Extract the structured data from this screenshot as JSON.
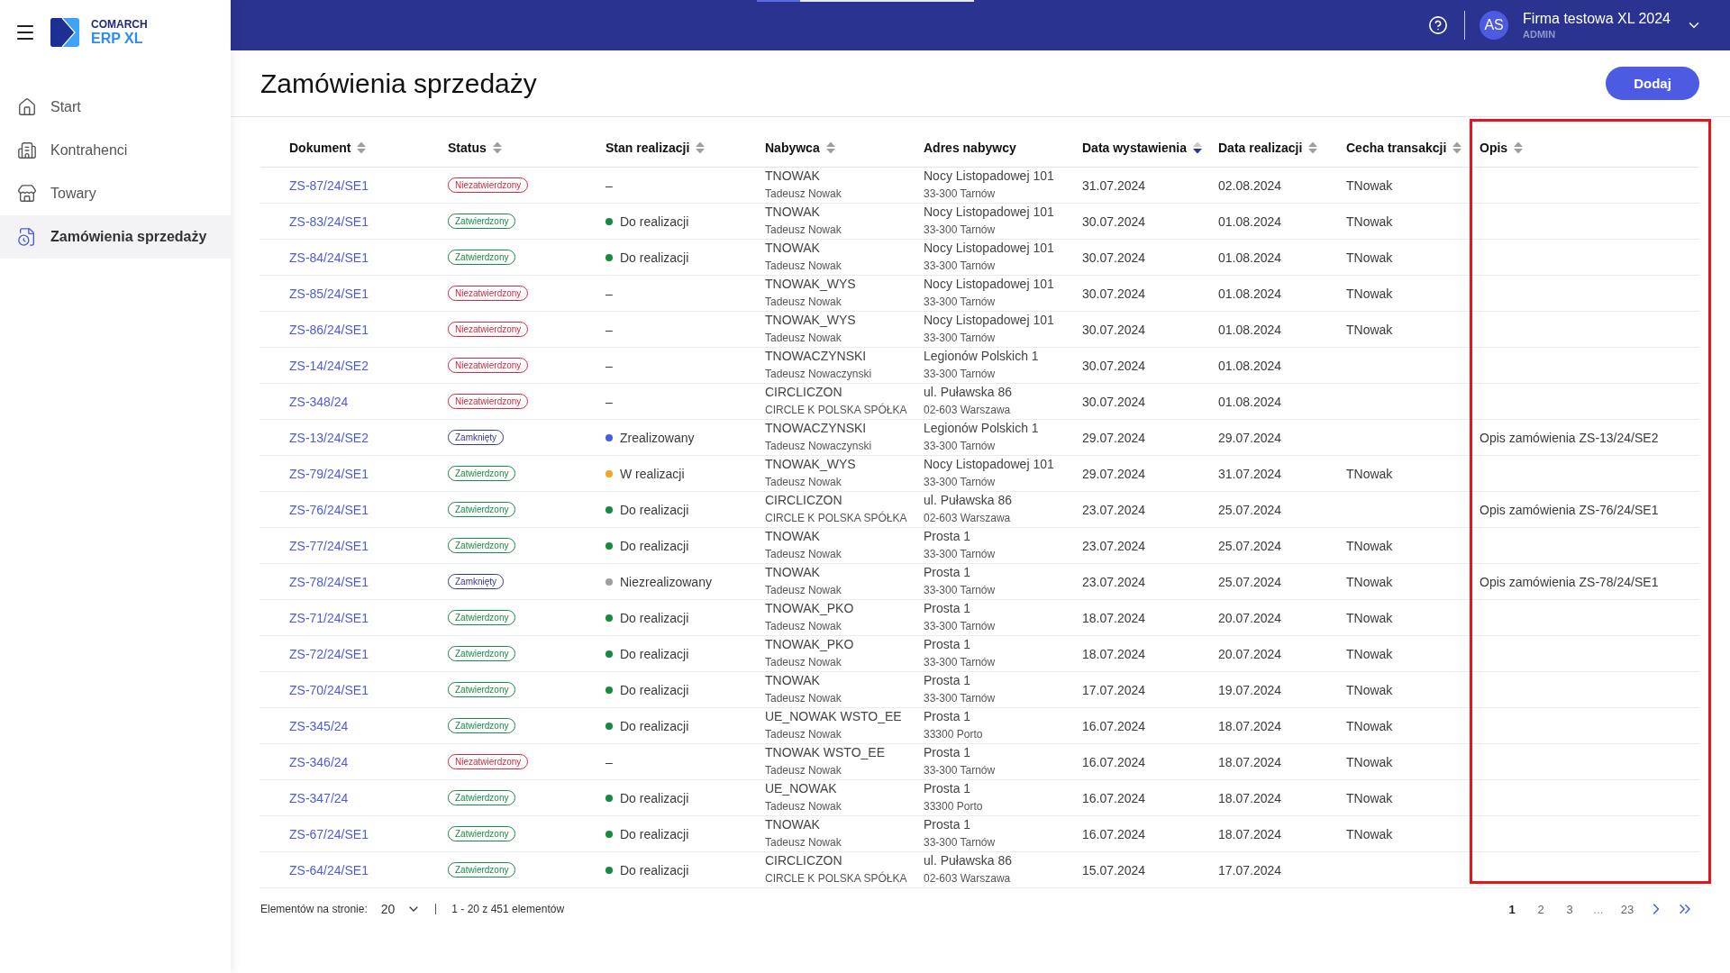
{
  "sidebar": {
    "logo": {
      "brand": "COMARCH",
      "product": "ERP XL"
    },
    "items": [
      {
        "label": "Start",
        "selected": false
      },
      {
        "label": "Kontrahenci",
        "selected": false
      },
      {
        "label": "Towary",
        "selected": false
      },
      {
        "label": "Zamówienia sprzedaży",
        "selected": true
      }
    ]
  },
  "top_bar": {
    "user": {
      "initials": "AS",
      "company": "Firma testowa XL 2024",
      "role": "ADMIN"
    }
  },
  "page": {
    "title": "Zamówienia sprzedaży",
    "add_button": "Dodaj"
  },
  "table": {
    "columns": [
      {
        "label": "Dokument",
        "sortable": true,
        "sorted_descending": false,
        "highlighted": false
      },
      {
        "label": "Status",
        "sortable": true,
        "sorted_descending": false,
        "highlighted": false
      },
      {
        "label": "Stan realizacji",
        "sortable": true,
        "sorted_descending": false,
        "highlighted": false
      },
      {
        "label": "Nabywca",
        "sortable": true,
        "sorted_descending": false,
        "highlighted": false
      },
      {
        "label": "Adres nabywcy",
        "sortable": false,
        "highlighted": false
      },
      {
        "label": "Data wystawienia",
        "sortable": true,
        "sorted_descending": true,
        "highlighted": false
      },
      {
        "label": "Data realizacji",
        "sortable": true,
        "sorted_descending": false,
        "highlighted": false
      },
      {
        "label": "Cecha transakcji",
        "sortable": true,
        "sorted_descending": false,
        "highlighted": false
      },
      {
        "label": "Opis",
        "sortable": true,
        "sorted_descending": false,
        "highlighted": true
      }
    ],
    "rows": [
      {
        "document": "ZS-87/24/SE1",
        "status": {
          "label": "Niezatwierdzony",
          "color": "#d7263d"
        },
        "progress": {
          "label": "–"
        },
        "buyer": {
          "code": "TNOWAK",
          "name": "Tadeusz Nowak"
        },
        "address": {
          "street": "Nocy Listopadowej 101",
          "city": "33-300 Tarnów"
        },
        "issue_date": "31.07.2024",
        "due_date": "02.08.2024",
        "feature": "TNowak"
      },
      {
        "document": "ZS-83/24/SE1",
        "status": {
          "label": "Zatwierdzony",
          "color": "#168a3e"
        },
        "progress": {
          "label": "Do realizacji",
          "color": "#168a3e"
        },
        "buyer": {
          "code": "TNOWAK",
          "name": "Tadeusz Nowak"
        },
        "address": {
          "street": "Nocy Listopadowej 101",
          "city": "33-300 Tarnów"
        },
        "issue_date": "30.07.2024",
        "due_date": "01.08.2024",
        "feature": "TNowak"
      },
      {
        "document": "ZS-84/24/SE1",
        "status": {
          "label": "Zatwierdzony",
          "color": "#168a3e"
        },
        "progress": {
          "label": "Do realizacji",
          "color": "#168a3e"
        },
        "buyer": {
          "code": "TNOWAK",
          "name": "Tadeusz Nowak"
        },
        "address": {
          "street": "Nocy Listopadowej 101",
          "city": "33-300 Tarnów"
        },
        "issue_date": "30.07.2024",
        "due_date": "01.08.2024",
        "feature": "TNowak"
      },
      {
        "document": "ZS-85/24/SE1",
        "status": {
          "label": "Niezatwierdzony",
          "color": "#d7263d"
        },
        "progress": {
          "label": "–"
        },
        "buyer": {
          "code": "TNOWAK_WYS",
          "name": "Tadeusz Nowak"
        },
        "address": {
          "street": "Nocy Listopadowej 101",
          "city": "33-300 Tarnów"
        },
        "issue_date": "30.07.2024",
        "due_date": "01.08.2024",
        "feature": "TNowak"
      },
      {
        "document": "ZS-86/24/SE1",
        "status": {
          "label": "Niezatwierdzony",
          "color": "#d7263d"
        },
        "progress": {
          "label": "–"
        },
        "buyer": {
          "code": "TNOWAK_WYS",
          "name": "Tadeusz Nowak"
        },
        "address": {
          "street": "Nocy Listopadowej 101",
          "city": "33-300 Tarnów"
        },
        "issue_date": "30.07.2024",
        "due_date": "01.08.2024",
        "feature": "TNowak"
      },
      {
        "document": "ZS-14/24/SE2",
        "status": {
          "label": "Niezatwierdzony",
          "color": "#d7263d"
        },
        "progress": {
          "label": "–"
        },
        "buyer": {
          "code": "TNOWACZYNSKI",
          "name": "Tadeusz Nowaczynski"
        },
        "address": {
          "street": "Legionów Polskich 1",
          "city": "33-300 Tarnów"
        },
        "issue_date": "30.07.2024",
        "due_date": "01.08.2024"
      },
      {
        "document": "ZS-348/24",
        "status": {
          "label": "Niezatwierdzony",
          "color": "#d7263d"
        },
        "progress": {
          "label": "–"
        },
        "buyer": {
          "code": "CIRCLICZON",
          "name": "CIRCLE K POLSKA SPÓŁKA"
        },
        "address": {
          "street": "ul. Puławska 86",
          "city": "02-603 Warszawa"
        },
        "issue_date": "30.07.2024",
        "due_date": "01.08.2024"
      },
      {
        "document": "ZS-13/24/SE2",
        "status": {
          "label": "Zamknięty",
          "color": "#2f3a8f"
        },
        "progress": {
          "label": "Zrealizowany",
          "color": "#4b5be0"
        },
        "buyer": {
          "code": "TNOWACZYNSKI",
          "name": "Tadeusz Nowaczynski"
        },
        "address": {
          "street": "Legionów Polskich 1",
          "city": "33-300 Tarnów"
        },
        "issue_date": "29.07.2024",
        "due_date": "29.07.2024",
        "description": "Opis zamówienia ZS-13/24/SE2"
      },
      {
        "document": "ZS-79/24/SE1",
        "status": {
          "label": "Zatwierdzony",
          "color": "#168a3e"
        },
        "progress": {
          "label": "W realizacji",
          "color": "#f5a524"
        },
        "buyer": {
          "code": "TNOWAK_WYS",
          "name": "Tadeusz Nowak"
        },
        "address": {
          "street": "Nocy Listopadowej 101",
          "city": "33-300 Tarnów"
        },
        "issue_date": "29.07.2024",
        "due_date": "31.07.2024",
        "feature": "TNowak"
      },
      {
        "document": "ZS-76/24/SE1",
        "status": {
          "label": "Zatwierdzony",
          "color": "#168a3e"
        },
        "progress": {
          "label": "Do realizacji",
          "color": "#168a3e"
        },
        "buyer": {
          "code": "CIRCLICZON",
          "name": "CIRCLE K POLSKA SPÓŁKA"
        },
        "address": {
          "street": "ul. Puławska 86",
          "city": "02-603 Warszawa"
        },
        "issue_date": "23.07.2024",
        "due_date": "25.07.2024",
        "description": "Opis zamówienia ZS-76/24/SE1"
      },
      {
        "document": "ZS-77/24/SE1",
        "status": {
          "label": "Zatwierdzony",
          "color": "#168a3e"
        },
        "progress": {
          "label": "Do realizacji",
          "color": "#168a3e"
        },
        "buyer": {
          "code": "TNOWAK",
          "name": "Tadeusz Nowak"
        },
        "address": {
          "street": "Prosta 1",
          "city": "33-300 Tarnów"
        },
        "issue_date": "23.07.2024",
        "due_date": "25.07.2024",
        "feature": "TNowak"
      },
      {
        "document": "ZS-78/24/SE1",
        "status": {
          "label": "Zamknięty",
          "color": "#2f3a8f"
        },
        "progress": {
          "label": "Niezrealizowany",
          "color": "#9e9e9e"
        },
        "buyer": {
          "code": "TNOWAK",
          "name": "Tadeusz Nowak"
        },
        "address": {
          "street": "Prosta 1",
          "city": "33-300 Tarnów"
        },
        "issue_date": "23.07.2024",
        "due_date": "25.07.2024",
        "feature": "TNowak",
        "description": "Opis zamówienia ZS-78/24/SE1"
      },
      {
        "document": "ZS-71/24/SE1",
        "status": {
          "label": "Zatwierdzony",
          "color": "#168a3e"
        },
        "progress": {
          "label": "Do realizacji",
          "color": "#168a3e"
        },
        "buyer": {
          "code": "TNOWAK_PKO",
          "name": "Tadeusz Nowak"
        },
        "address": {
          "street": "Prosta 1",
          "city": "33-300 Tarnów"
        },
        "issue_date": "18.07.2024",
        "due_date": "20.07.2024",
        "feature": "TNowak"
      },
      {
        "document": "ZS-72/24/SE1",
        "status": {
          "label": "Zatwierdzony",
          "color": "#168a3e"
        },
        "progress": {
          "label": "Do realizacji",
          "color": "#168a3e"
        },
        "buyer": {
          "code": "TNOWAK_PKO",
          "name": "Tadeusz Nowak"
        },
        "address": {
          "street": "Prosta 1",
          "city": "33-300 Tarnów"
        },
        "issue_date": "18.07.2024",
        "due_date": "20.07.2024",
        "feature": "TNowak"
      },
      {
        "document": "ZS-70/24/SE1",
        "status": {
          "label": "Zatwierdzony",
          "color": "#168a3e"
        },
        "progress": {
          "label": "Do realizacji",
          "color": "#168a3e"
        },
        "buyer": {
          "code": "TNOWAK",
          "name": "Tadeusz Nowak"
        },
        "address": {
          "street": "Prosta 1",
          "city": "33-300 Tarnów"
        },
        "issue_date": "17.07.2024",
        "due_date": "19.07.2024",
        "feature": "TNowak"
      },
      {
        "document": "ZS-345/24",
        "status": {
          "label": "Zatwierdzony",
          "color": "#168a3e"
        },
        "progress": {
          "label": "Do realizacji",
          "color": "#168a3e"
        },
        "buyer": {
          "code": "UE_NOWAK WSTO_EE",
          "name": "Tadeusz Nowak"
        },
        "address": {
          "street": "Prosta 1",
          "city": "33300 Porto"
        },
        "issue_date": "16.07.2024",
        "due_date": "18.07.2024",
        "feature": "TNowak"
      },
      {
        "document": "ZS-346/24",
        "status": {
          "label": "Niezatwierdzony",
          "color": "#d7263d"
        },
        "progress": {
          "label": "–"
        },
        "buyer": {
          "code": "TNOWAK WSTO_EE",
          "name": "Tadeusz Nowak"
        },
        "address": {
          "street": "Prosta 1",
          "city": "33-300 Tarnów"
        },
        "issue_date": "16.07.2024",
        "due_date": "18.07.2024",
        "feature": "TNowak"
      },
      {
        "document": "ZS-347/24",
        "status": {
          "label": "Zatwierdzony",
          "color": "#168a3e"
        },
        "progress": {
          "label": "Do realizacji",
          "color": "#168a3e"
        },
        "buyer": {
          "code": "UE_NOWAK",
          "name": "Tadeusz Nowak"
        },
        "address": {
          "street": "Prosta 1",
          "city": "33300 Porto"
        },
        "issue_date": "16.07.2024",
        "due_date": "18.07.2024",
        "feature": "TNowak"
      },
      {
        "document": "ZS-67/24/SE1",
        "status": {
          "label": "Zatwierdzony",
          "color": "#168a3e"
        },
        "progress": {
          "label": "Do realizacji",
          "color": "#168a3e"
        },
        "buyer": {
          "code": "TNOWAK",
          "name": "Tadeusz Nowak"
        },
        "address": {
          "street": "Prosta 1",
          "city": "33-300 Tarnów"
        },
        "issue_date": "16.07.2024",
        "due_date": "18.07.2024",
        "feature": "TNowak"
      },
      {
        "document": "ZS-64/24/SE1",
        "status": {
          "label": "Zatwierdzony",
          "color": "#168a3e"
        },
        "progress": {
          "label": "Do realizacji",
          "color": "#168a3e"
        },
        "buyer": {
          "code": "CIRCLICZON",
          "name": "CIRCLE K POLSKA SPÓŁKA"
        },
        "address": {
          "street": "ul. Puławska 86",
          "city": "02-603 Warszawa"
        },
        "issue_date": "15.07.2024",
        "due_date": "17.07.2024"
      }
    ]
  },
  "pagination": {
    "page_size_label": "Elementów na stronie:",
    "page_size": "20",
    "range": "1 - 20 z 451 elementów",
    "pages": [
      {
        "label": "1",
        "kind": "page",
        "selected": true
      },
      {
        "label": "2",
        "kind": "page",
        "selected": false
      },
      {
        "label": "3",
        "kind": "page",
        "selected": false
      },
      {
        "label": "...",
        "kind": "ellipsis",
        "selected": false
      },
      {
        "label": "23",
        "kind": "page",
        "selected": false
      }
    ]
  }
}
